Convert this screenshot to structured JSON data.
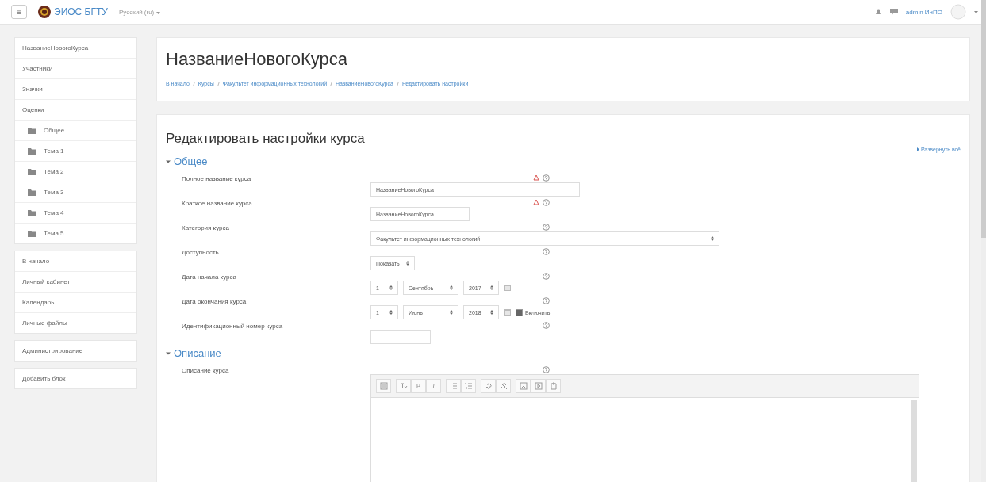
{
  "navbar": {
    "menu_toggle": "≡",
    "site_name": "ЭИОС БГТУ",
    "language": "Русский (ru)",
    "user_name": "admin ИнПО"
  },
  "sidebar": {
    "blocks": [
      {
        "items": [
          {
            "label": "НазваниеНовогоКурса",
            "kind": "link"
          },
          {
            "label": "Участники",
            "kind": "link"
          },
          {
            "label": "Значки",
            "kind": "link"
          },
          {
            "label": "Оценки",
            "kind": "link"
          },
          {
            "label": "Общее",
            "kind": "section"
          },
          {
            "label": "Тема 1",
            "kind": "section"
          },
          {
            "label": "Тема 2",
            "kind": "section"
          },
          {
            "label": "Тема 3",
            "kind": "section"
          },
          {
            "label": "Тема 4",
            "kind": "section"
          },
          {
            "label": "Тема 5",
            "kind": "section"
          }
        ]
      },
      {
        "items": [
          {
            "label": "В начало",
            "kind": "link"
          },
          {
            "label": "Личный кабинет",
            "kind": "link"
          },
          {
            "label": "Календарь",
            "kind": "link"
          },
          {
            "label": "Личные файлы",
            "kind": "link"
          }
        ]
      },
      {
        "items": [
          {
            "label": "Администрирование",
            "kind": "link"
          }
        ]
      },
      {
        "items": [
          {
            "label": "Добавить блок",
            "kind": "link"
          }
        ]
      }
    ]
  },
  "header": {
    "title": "НазваниеНовогоКурса",
    "breadcrumb": [
      "В начало",
      "Курсы",
      "Факультет информационных технологий",
      "НазваниеНовогоКурса",
      "Редактировать настройки"
    ]
  },
  "form": {
    "title": "Редактировать настройки курса",
    "expand_all": "Развернуть всё",
    "sections": [
      {
        "title": "Общее",
        "expanded": true,
        "fields": [
          {
            "label": "Полное название курса",
            "required": true,
            "kind": "text",
            "value": "НазваниеНовогоКурса"
          },
          {
            "label": "Краткое название курса",
            "required": true,
            "kind": "text",
            "value": "НазваниеНовогоКурса"
          },
          {
            "label": "Категория курса",
            "required": false,
            "kind": "select",
            "value": "Факультет информационных технологий"
          },
          {
            "label": "Доступность",
            "required": false,
            "kind": "select",
            "value": "Показать"
          },
          {
            "label": "Дата начала курса",
            "required": false,
            "kind": "date",
            "parts": [
              "1",
              "Сентябрь",
              "2017"
            ]
          },
          {
            "label": "Дата окончания курса",
            "required": false,
            "kind": "date",
            "parts": [
              "1",
              "Июнь",
              "2018"
            ],
            "enable": {
              "label": "Включить",
              "checked": true
            }
          },
          {
            "label": "Идентификационный номер курса",
            "required": false,
            "kind": "text"
          }
        ]
      },
      {
        "title": "Описание",
        "expanded": true,
        "fields": [
          {
            "label": "Описание курса",
            "required": false,
            "kind": "editor",
            "bold": "B",
            "italic": "I"
          }
        ]
      }
    ]
  }
}
